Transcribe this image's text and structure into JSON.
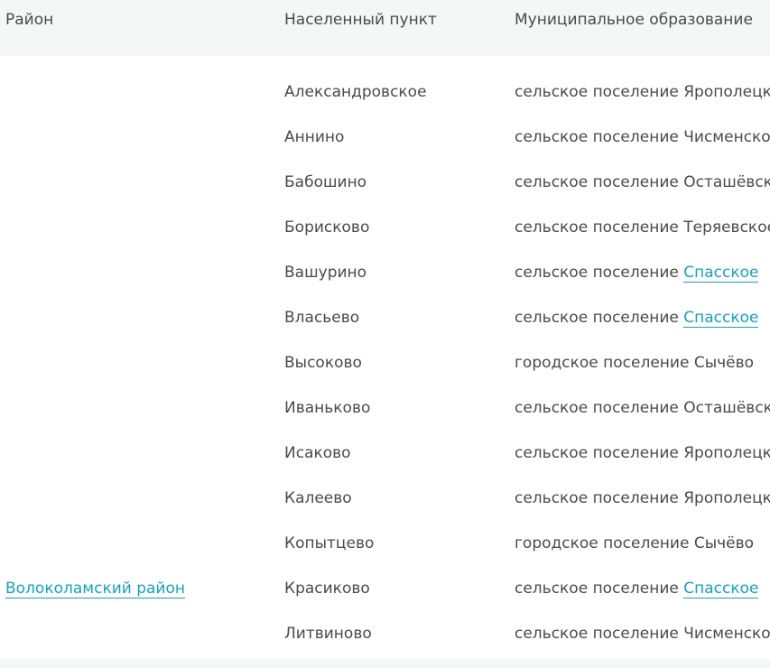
{
  "headers": {
    "district": "Район",
    "locality": "Населенный пункт",
    "municipality": "Муниципальное образование"
  },
  "district_link": "Волоколамский район",
  "rows": [
    {
      "locality": "Александровское",
      "muni_prefix": "сельское поселение Ярополецкое",
      "muni_link": ""
    },
    {
      "locality": "Аннино",
      "muni_prefix": "сельское поселение Чисменское",
      "muni_link": ""
    },
    {
      "locality": "Бабошино",
      "muni_prefix": "сельское поселение Осташёвское",
      "muni_link": ""
    },
    {
      "locality": "Борисково",
      "muni_prefix": "сельское поселение Теряевское",
      "muni_link": ""
    },
    {
      "locality": "Вашурино",
      "muni_prefix": "сельское поселение ",
      "muni_link": "Спасское"
    },
    {
      "locality": "Власьево",
      "muni_prefix": "сельское поселение ",
      "muni_link": "Спасское"
    },
    {
      "locality": "Высоково",
      "muni_prefix": "городское поселение Сычёво",
      "muni_link": ""
    },
    {
      "locality": "Иваньково",
      "muni_prefix": "сельское поселение Осташёвское",
      "muni_link": ""
    },
    {
      "locality": "Исаково",
      "muni_prefix": "сельское поселение Ярополецкое",
      "muni_link": ""
    },
    {
      "locality": "Калеево",
      "muni_prefix": "сельское поселение Ярополецкое",
      "muni_link": ""
    },
    {
      "locality": "Копытцево",
      "muni_prefix": "городское поселение Сычёво",
      "muni_link": ""
    },
    {
      "locality": "Красиково",
      "muni_prefix": "сельское поселение ",
      "muni_link": "Спасское"
    },
    {
      "locality": "Литвиново",
      "muni_prefix": "сельское поселение Чисменское",
      "muni_link": ""
    }
  ]
}
